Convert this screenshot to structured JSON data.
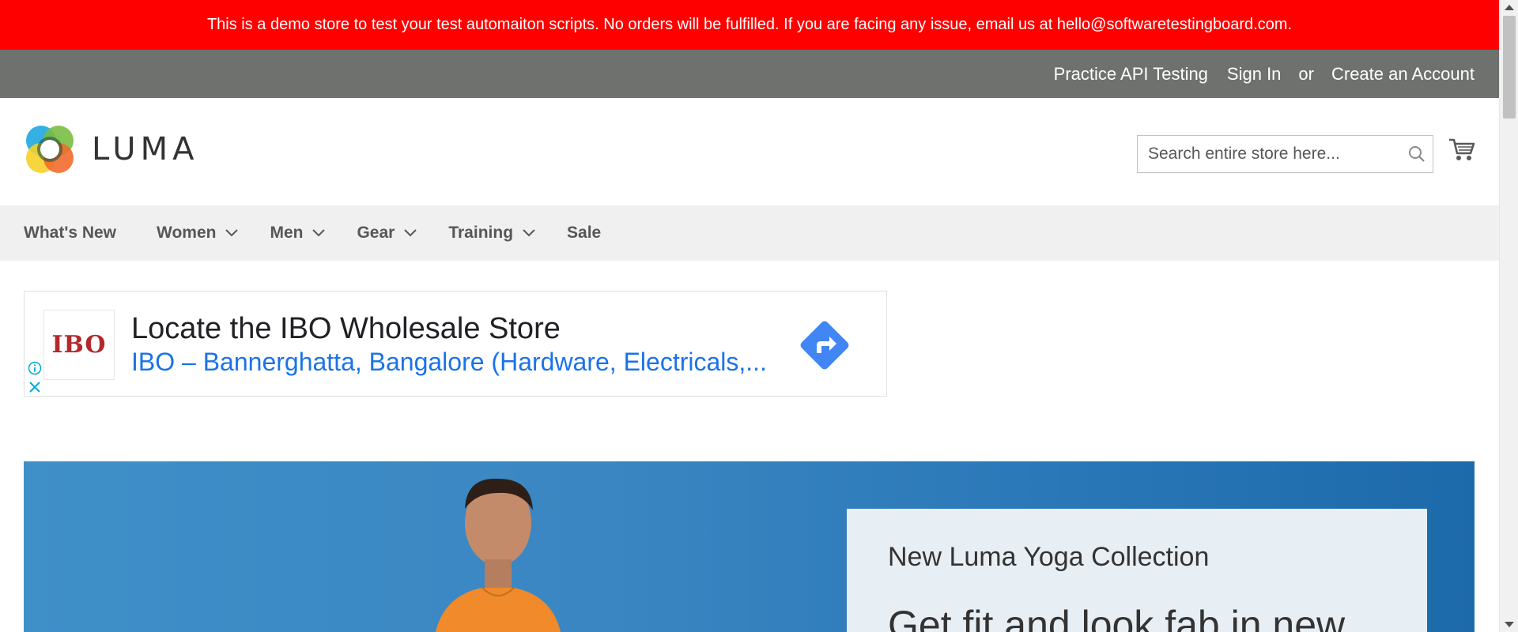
{
  "demo_banner": {
    "text": "This is a demo store to test your test automaiton scripts. No orders will be fulfilled. If you are facing any issue, email us at hello@softwaretestingboard.com."
  },
  "top_bar": {
    "practice_api_label": "Practice API Testing",
    "sign_in_label": "Sign In",
    "or_text": "or",
    "create_account_label": "Create an Account"
  },
  "header": {
    "logo_text": "LUMA",
    "search": {
      "placeholder": "Search entire store here...",
      "value": ""
    }
  },
  "nav": {
    "items": [
      {
        "label": "What's New",
        "has_dropdown": false
      },
      {
        "label": "Women",
        "has_dropdown": true
      },
      {
        "label": "Men",
        "has_dropdown": true
      },
      {
        "label": "Gear",
        "has_dropdown": true
      },
      {
        "label": "Training",
        "has_dropdown": true
      },
      {
        "label": "Sale",
        "has_dropdown": false
      }
    ]
  },
  "ad": {
    "logo_text": "IBO",
    "title": "Locate the IBO Wholesale Store",
    "subtitle": "IBO – Bannerghatta, Bangalore (Hardware, Electricals,...",
    "icons": [
      "info-icon",
      "close-icon",
      "directions-icon"
    ]
  },
  "hero": {
    "kicker": "New Luma Yoga Collection",
    "headline": "Get fit and look fab in new"
  },
  "colors": {
    "banner_red": "#fe0000",
    "top_bar_gray": "#6e716e",
    "nav_bg": "#f0f0f0",
    "ad_link_blue": "#1a73e8",
    "hero_blue": "#2b78b8"
  }
}
